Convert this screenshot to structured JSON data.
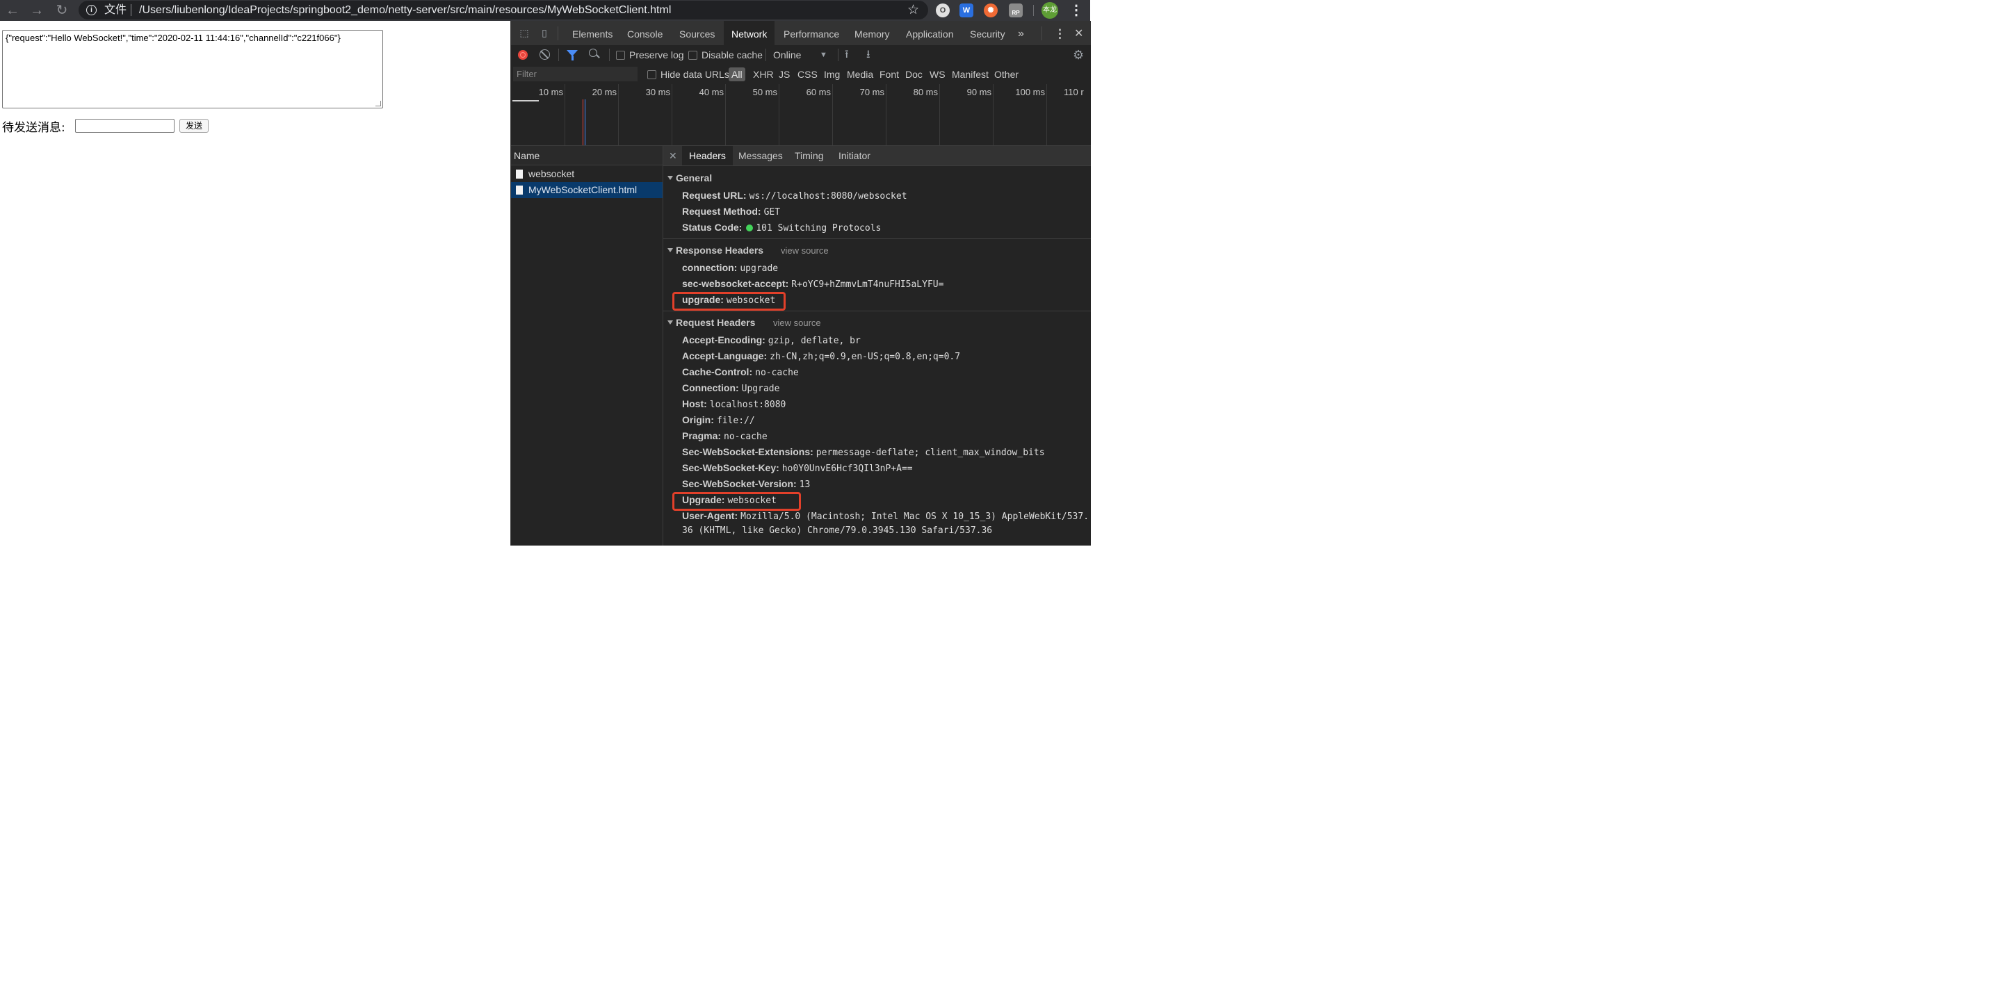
{
  "browser": {
    "scheme_label": "文件",
    "url": "/Users/liubenlong/IdeaProjects/springboot2_demo/netty-server/src/main/resources/MyWebSocketClient.html",
    "extensions": [
      {
        "name": "opera-icon",
        "label": "O",
        "color": "#b5b5b5"
      },
      {
        "name": "w-extension-icon",
        "label": "W",
        "color": "#2a6fe0"
      },
      {
        "name": "orange-extension-icon",
        "label": "✺",
        "color": "#f06a35"
      },
      {
        "name": "rp-extension-icon",
        "label": "RP",
        "color": "#8a8a8a"
      }
    ],
    "profile_label": "本龙",
    "profile_color": "#5e9e35"
  },
  "page": {
    "message_text": "{\"request\":\"Hello WebSocket!\",\"time\":\"2020-02-11 11:44:16\",\"channelId\":\"c221f066\"}",
    "send_label": "待发送消息:",
    "send_input_value": "",
    "send_button": "发送"
  },
  "devtools": {
    "tabs": [
      "Elements",
      "Console",
      "Sources",
      "Network",
      "Performance",
      "Memory",
      "Application",
      "Security"
    ],
    "active_tab": "Network",
    "toolbar": {
      "preserve_log": "Preserve log",
      "disable_cache": "Disable cache",
      "throttling": "Online"
    },
    "filter": {
      "placeholder": "Filter",
      "hide_data_urls": "Hide data URLs",
      "types": [
        "All",
        "XHR",
        "JS",
        "CSS",
        "Img",
        "Media",
        "Font",
        "Doc",
        "WS",
        "Manifest",
        "Other"
      ],
      "active_type": "All"
    },
    "timeline_ticks": [
      "10 ms",
      "20 ms",
      "30 ms",
      "40 ms",
      "50 ms",
      "60 ms",
      "70 ms",
      "80 ms",
      "90 ms",
      "100 ms",
      "110 r"
    ],
    "requests_header": "Name",
    "requests": [
      {
        "name": "websocket",
        "selected": false
      },
      {
        "name": "MyWebSocketClient.html",
        "selected": true
      }
    ],
    "detail_tabs": [
      "Headers",
      "Messages",
      "Timing",
      "Initiator"
    ],
    "active_detail_tab": "Headers",
    "general": {
      "title": "General",
      "rows": [
        {
          "name": "Request URL:",
          "value": "ws://localhost:8080/websocket"
        },
        {
          "name": "Request Method:",
          "value": "GET"
        },
        {
          "name": "Status Code:",
          "value": "101 Switching Protocols"
        }
      ]
    },
    "response_headers": {
      "title": "Response Headers",
      "view_source": "view source",
      "rows": [
        {
          "name": "connection:",
          "value": "upgrade"
        },
        {
          "name": "sec-websocket-accept:",
          "value": "R+oYC9+hZmmvLmT4nuFHI5aLYFU="
        },
        {
          "name": "upgrade:",
          "value": "websocket"
        }
      ]
    },
    "request_headers": {
      "title": "Request Headers",
      "view_source": "view source",
      "rows": [
        {
          "name": "Accept-Encoding:",
          "value": "gzip, deflate, br"
        },
        {
          "name": "Accept-Language:",
          "value": "zh-CN,zh;q=0.9,en-US;q=0.8,en;q=0.7"
        },
        {
          "name": "Cache-Control:",
          "value": "no-cache"
        },
        {
          "name": "Connection:",
          "value": "Upgrade"
        },
        {
          "name": "Host:",
          "value": "localhost:8080"
        },
        {
          "name": "Origin:",
          "value": "file://"
        },
        {
          "name": "Pragma:",
          "value": "no-cache"
        },
        {
          "name": "Sec-WebSocket-Extensions:",
          "value": "permessage-deflate; client_max_window_bits"
        },
        {
          "name": "Sec-WebSocket-Key:",
          "value": "ho0Y0UnvE6Hcf3QIl3nP+A=="
        },
        {
          "name": "Sec-WebSocket-Version:",
          "value": "13"
        },
        {
          "name": "Upgrade:",
          "value": "websocket"
        },
        {
          "name": "User-Agent:",
          "value": "Mozilla/5.0 (Macintosh; Intel Mac OS X 10_15_3) AppleWebKit/537."
        }
      ],
      "user_agent_wrap": "36 (KHTML, like Gecko) Chrome/79.0.3945.130 Safari/537.36"
    },
    "highlight_color": "#e2402a",
    "status_color": "#43d35a"
  }
}
